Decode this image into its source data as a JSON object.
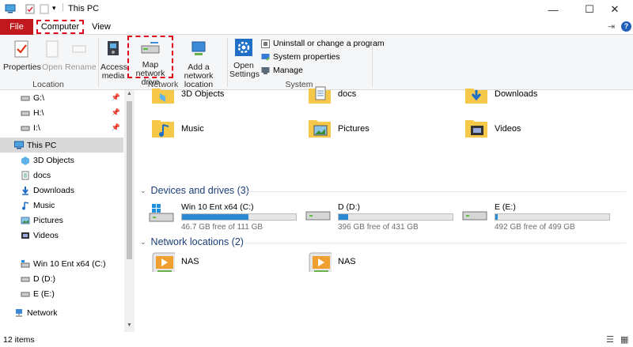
{
  "window": {
    "title": "This PC",
    "min_glyph": "—",
    "max_glyph": "☐",
    "close_glyph": "✕"
  },
  "tabs": {
    "file": "File",
    "computer": "Computer",
    "view": "View"
  },
  "ribbon": {
    "location": {
      "label": "Location",
      "properties": "Properties",
      "open": "Open",
      "rename": "Rename"
    },
    "network": {
      "label": "Network",
      "access_media": "Access media",
      "map_drive": "Map network drive",
      "add_location": "Add a network location"
    },
    "system": {
      "label": "System",
      "open_settings": "Open Settings",
      "uninstall": "Uninstall or change a program",
      "system_properties": "System properties",
      "manage": "Manage"
    }
  },
  "sidebar": {
    "quick": [
      {
        "label": "G:\\"
      },
      {
        "label": "H:\\"
      },
      {
        "label": "I:\\"
      }
    ],
    "this_pc": "This PC",
    "pc_items": [
      "3D Objects",
      "docs",
      "Downloads",
      "Music",
      "Pictures",
      "Videos"
    ],
    "drives": [
      "Win 10 Ent x64 (C:)",
      "D (D:)",
      "E (E:)"
    ],
    "network": "Network"
  },
  "folders": [
    "3D Objects",
    "docs",
    "Downloads",
    "Music",
    "Pictures",
    "Videos"
  ],
  "sections": {
    "devices": "Devices and drives (3)",
    "netloc": "Network locations (2)"
  },
  "drives": [
    {
      "name": "Win 10 Ent x64 (C:)",
      "free": "46.7 GB free of 111 GB",
      "used_fraction": 0.58
    },
    {
      "name": "D (D:)",
      "free": "396 GB free of 431 GB",
      "used_fraction": 0.08
    },
    {
      "name": "E (E:)",
      "free": "492 GB free of 499 GB",
      "used_fraction": 0.02
    }
  ],
  "network_locations": [
    "NAS",
    "NAS"
  ],
  "status": {
    "items": "12 items"
  },
  "colors": {
    "accent": "#c0181c",
    "highlight": "#e0001a",
    "bar": "#2a8ad4"
  }
}
